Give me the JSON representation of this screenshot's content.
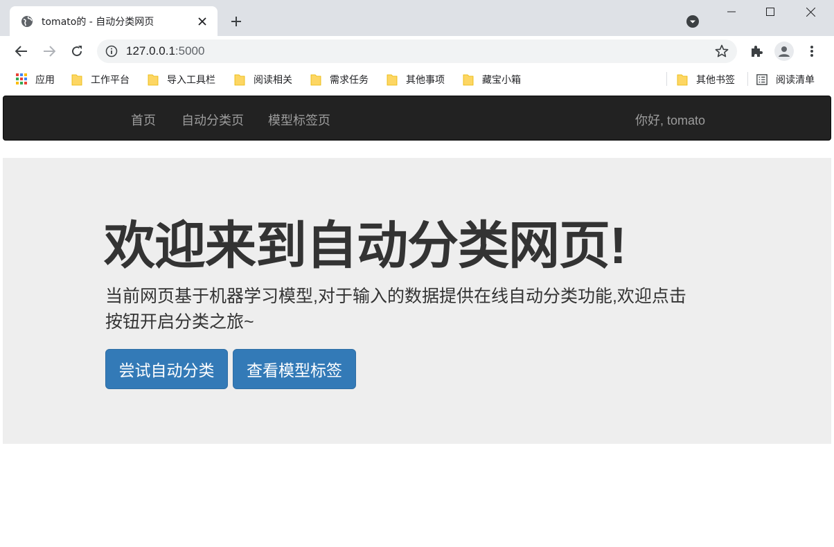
{
  "browser": {
    "tab": {
      "title": "tomato的 - 自动分类网页",
      "favicon": "globe-icon"
    },
    "address": {
      "host": "127.0.0.1",
      "port": ":5000"
    },
    "bookmarks": [
      {
        "label": "应用",
        "icon": "apps-grid-icon"
      },
      {
        "label": "工作平台",
        "icon": "folder-icon"
      },
      {
        "label": "导入工具栏",
        "icon": "folder-icon"
      },
      {
        "label": "阅读相关",
        "icon": "folder-icon"
      },
      {
        "label": "需求任务",
        "icon": "folder-icon"
      },
      {
        "label": "其他事项",
        "icon": "folder-icon"
      },
      {
        "label": "藏宝小箱",
        "icon": "folder-icon"
      }
    ],
    "other_bookmarks": "其他书签",
    "reading_list": "阅读清单"
  },
  "navbar": {
    "links": [
      "首页",
      "自动分类页",
      "模型标签页"
    ],
    "greeting": "你好, tomato"
  },
  "jumbotron": {
    "title": "欢迎来到自动分类网页!",
    "line1": "当前网页基于机器学习模型,对于输入的数据提供在线自动分类功能,欢迎点击",
    "line2": "按钮开启分类之旅~",
    "buttons": [
      "尝试自动分类",
      "查看模型标签"
    ]
  },
  "colors": {
    "navbar_bg": "#222222",
    "jumbotron_bg": "#eeeeee",
    "primary_button": "#337ab7"
  }
}
